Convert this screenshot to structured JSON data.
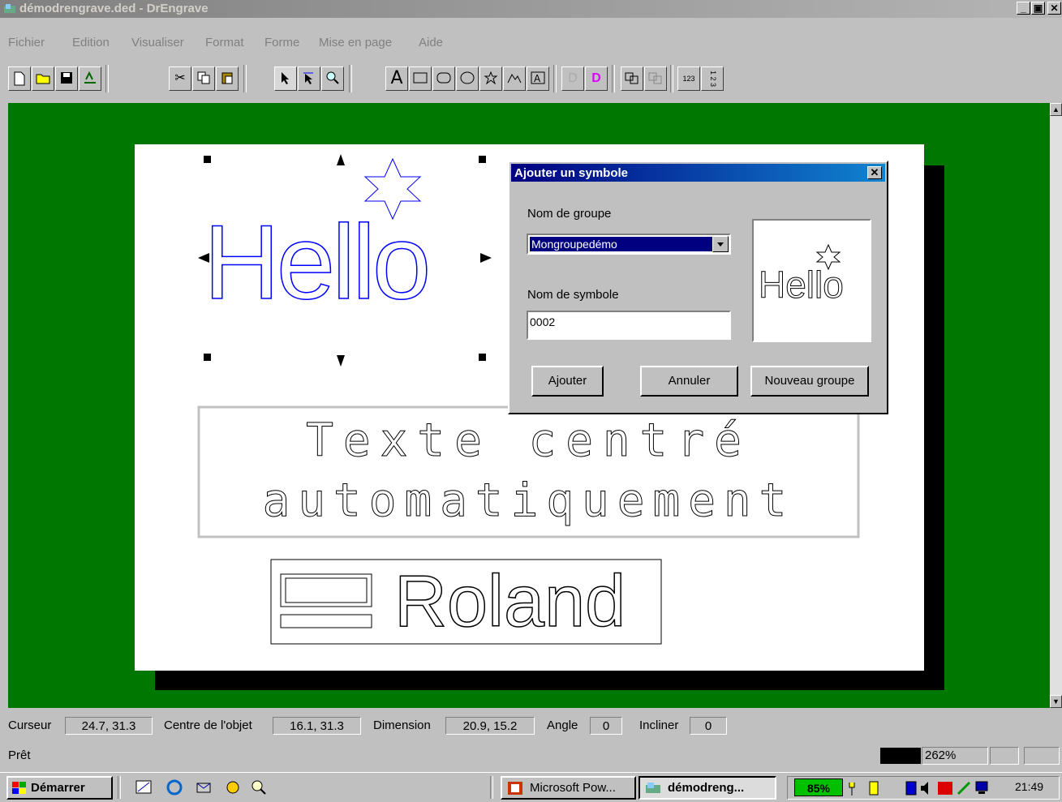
{
  "window": {
    "title": "démodrengrave.ded - DrEngrave",
    "min": "_",
    "max": "▣",
    "close": "✕"
  },
  "menu": [
    "Fichier",
    "Edition",
    "Visualiser",
    "Format",
    "Forme",
    "Mise en page",
    "Aide"
  ],
  "toolbar": {
    "text_tool": "A",
    "numbering_label": "123",
    "fraction_label": "1 2 3"
  },
  "canvas": {
    "hello_text": "Hello",
    "centered_line1": "Texte centré",
    "centered_line2": "automatiquement",
    "logo_text": "Roland",
    "background_color": "#007800"
  },
  "dialog": {
    "title": "Ajouter un symbole",
    "close": "✕",
    "group_label": "Nom de groupe",
    "group_value": "Mongroupedémo",
    "symbol_label": "Nom de symbole",
    "symbol_value": "0002",
    "preview_text": "Hello",
    "btn_add": "Ajouter",
    "btn_cancel": "Annuler",
    "btn_new_group": "Nouveau groupe"
  },
  "status": {
    "cursor_label": "Curseur",
    "cursor_value": "24.7, 31.3",
    "center_label": "Centre de l'objet",
    "center_value": "16.1, 31.3",
    "dimension_label": "Dimension",
    "dimension_value": "20.9, 15.2",
    "angle_label": "Angle",
    "angle_value": "0",
    "incline_label": "Incliner",
    "incline_value": "0",
    "ready": "Prêt",
    "zoom": "262%"
  },
  "taskbar": {
    "start": "Démarrer",
    "task1": "Microsoft Pow...",
    "task2": "démodreng...",
    "battery": "85%",
    "clock": "21:49"
  }
}
